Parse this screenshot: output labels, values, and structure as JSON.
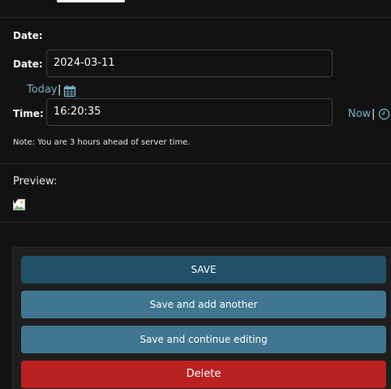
{
  "date_section": {
    "heading": "Date:",
    "date_label": "Date:",
    "date_value": "2024-03-11",
    "today_link": "Today",
    "separator": "|",
    "time_label": "Time:",
    "time_value": "16:20:35",
    "now_link": "Now",
    "note": "Note: You are 3 hours ahead of server time."
  },
  "preview": {
    "label": "Preview:"
  },
  "submit_row": {
    "save": "SAVE",
    "save_add": "Save and add another",
    "save_continue": "Save and continue editing",
    "delete": "Delete"
  },
  "icons": {
    "calendar": "calendar-icon",
    "clock": "clock-icon",
    "broken_image": "broken-image-icon"
  },
  "colors": {
    "link": "#79aec8",
    "primary": "#205067",
    "secondary": "#417690",
    "danger": "#ba2121",
    "background": "#121212"
  }
}
